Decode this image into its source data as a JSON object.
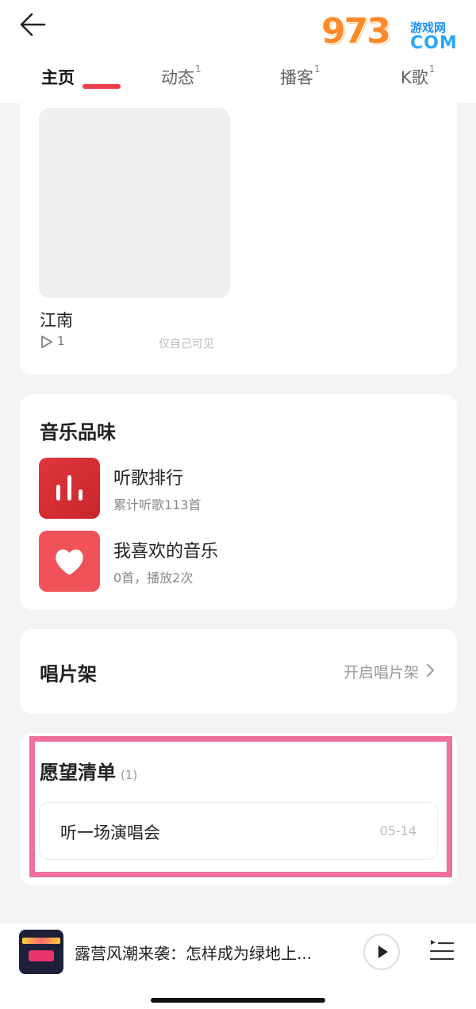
{
  "header": {
    "back_icon": "back-arrow-icon",
    "logo": {
      "main": "9",
      "rest": "73",
      "sub": "游戏网",
      "com": "COM"
    }
  },
  "tabs": [
    {
      "label": "主页",
      "badge": "",
      "active": true
    },
    {
      "label": "动态",
      "badge": "1",
      "active": false
    },
    {
      "label": "播客",
      "badge": "1",
      "active": false
    },
    {
      "label": "K歌",
      "badge": "1",
      "active": false
    }
  ],
  "song": {
    "title": "江南",
    "play_count": "1",
    "visibility": "仅自己可见"
  },
  "music_taste": {
    "title": "音乐品味",
    "items": [
      {
        "label": "听歌排行",
        "sub": "累计听歌113首",
        "icon": "bar-chart-icon"
      },
      {
        "label": "我喜欢的音乐",
        "sub": "0首，播放2次",
        "icon": "heart-icon"
      }
    ]
  },
  "record_shelf": {
    "title": "唱片架",
    "link": "开启唱片架"
  },
  "wishlist": {
    "title": "愿望清单",
    "count": "(1)",
    "items": [
      {
        "label": "听一场演唱会",
        "date": "05-14"
      }
    ]
  },
  "player": {
    "title": "露营风潮来袭：怎样成为绿地上..."
  },
  "colors": {
    "accent": "#ee3f4d",
    "highlight": "#f0709a",
    "background": "#f4f4f4"
  }
}
